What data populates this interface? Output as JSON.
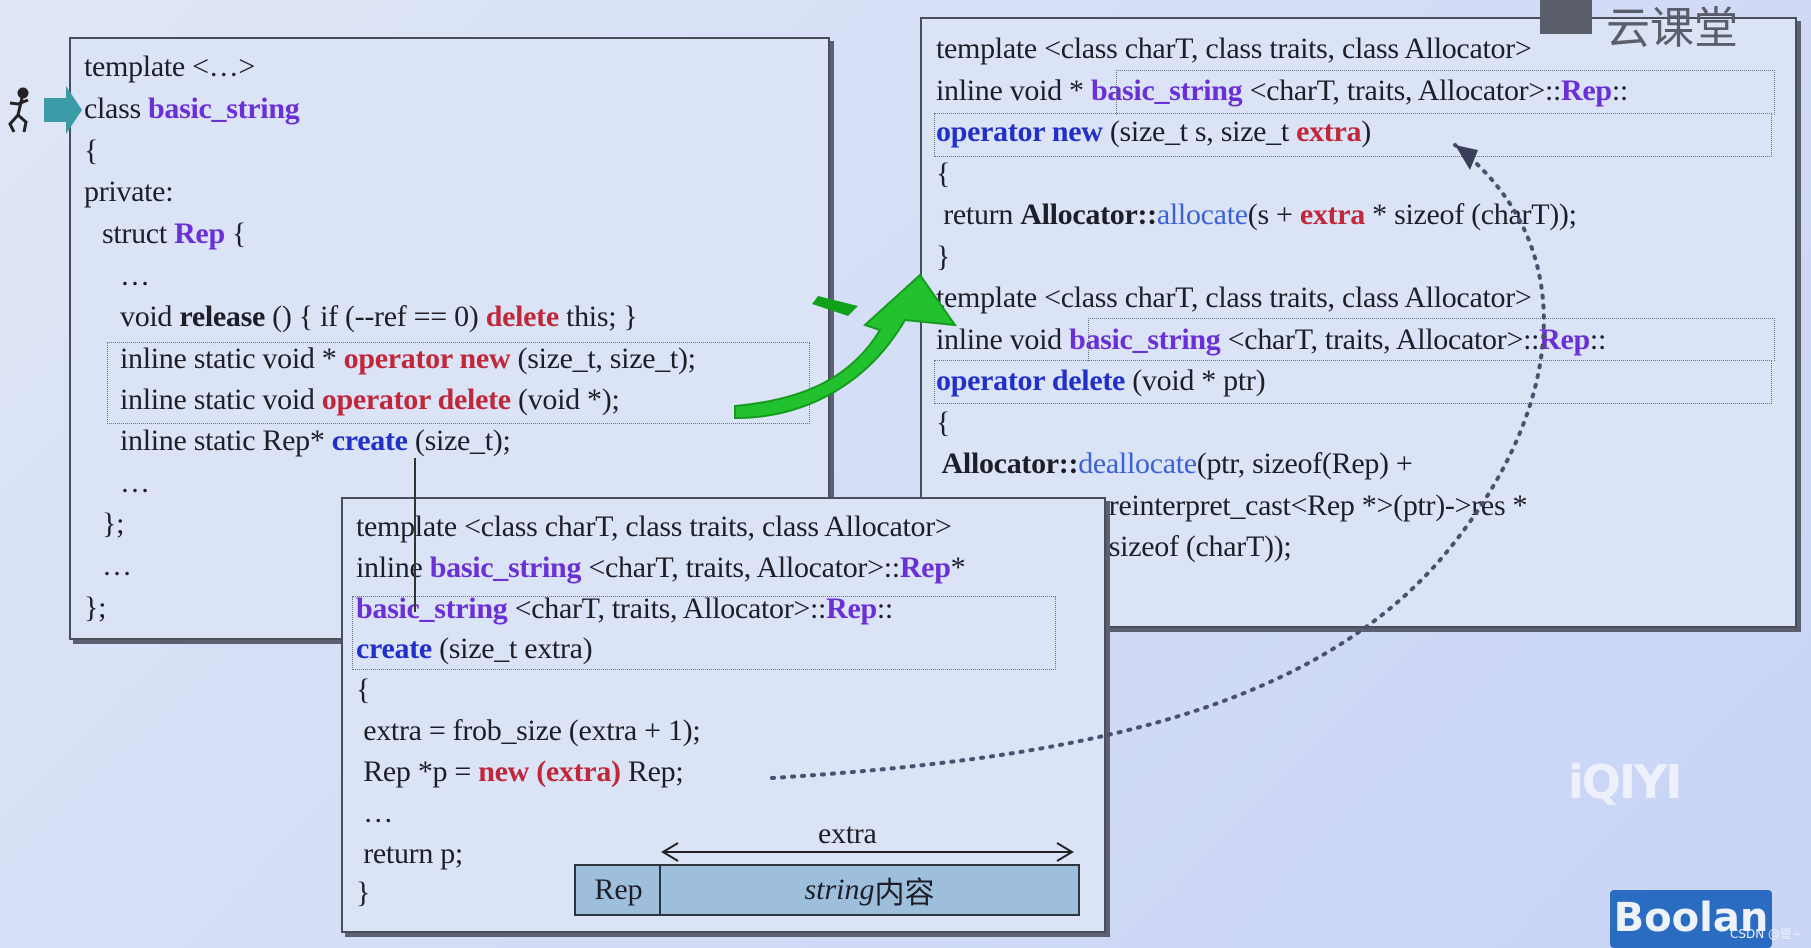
{
  "left_box": {
    "lines": [
      {
        "parts": [
          [
            "template <…>",
            ""
          ]
        ]
      },
      {
        "parts": [
          [
            "class ",
            ""
          ],
          [
            "basic_string",
            "kw-purple"
          ]
        ]
      },
      {
        "parts": [
          [
            "{",
            ""
          ]
        ]
      },
      {
        "parts": [
          [
            "private:",
            ""
          ]
        ]
      },
      {
        "parts": [
          [
            "struct ",
            ""
          ],
          [
            "Rep",
            "kw-purple"
          ],
          [
            " {",
            ""
          ]
        ]
      },
      {
        "parts": [
          [
            "…",
            ""
          ]
        ]
      },
      {
        "parts": [
          [
            "void ",
            ""
          ],
          [
            "release",
            "bold"
          ],
          [
            " () { if (--ref == 0) ",
            ""
          ],
          [
            "delete",
            "kw-red"
          ],
          [
            " this; }",
            ""
          ]
        ]
      },
      {
        "parts": [
          [
            "inline static void * ",
            ""
          ],
          [
            "operator new",
            "kw-red"
          ],
          [
            " (size_t, size_t);",
            ""
          ]
        ]
      },
      {
        "parts": [
          [
            "inline static void ",
            ""
          ],
          [
            "operator delete",
            "kw-red"
          ],
          [
            " (void *);",
            ""
          ]
        ]
      },
      {
        "parts": [
          [
            "inline static Rep* ",
            ""
          ],
          [
            "create",
            "kw-blue"
          ],
          [
            " (size_t);",
            ""
          ]
        ]
      },
      {
        "parts": [
          [
            "…",
            ""
          ]
        ]
      },
      {
        "parts": [
          [
            "};",
            ""
          ]
        ]
      },
      {
        "parts": [
          [
            "…",
            ""
          ]
        ]
      },
      {
        "parts": [
          [
            "};",
            ""
          ]
        ]
      }
    ]
  },
  "right_box": {
    "lines": [
      {
        "parts": [
          [
            "template <class charT, class traits, class Allocator>",
            ""
          ]
        ]
      },
      {
        "parts": [
          [
            "inline void * ",
            ""
          ],
          [
            "basic_string",
            "kw-purple"
          ],
          [
            " <charT, traits, Allocator>::",
            ""
          ],
          [
            "Rep",
            "kw-purple"
          ],
          [
            "::",
            ""
          ]
        ]
      },
      {
        "parts": [
          [
            "operator new",
            "kw-blue"
          ],
          [
            " (size_t s, size_t ",
            ""
          ],
          [
            "extra",
            "kw-red"
          ],
          [
            ")",
            ""
          ]
        ]
      },
      {
        "parts": [
          [
            "{",
            ""
          ]
        ]
      },
      {
        "parts": [
          [
            " return ",
            ""
          ],
          [
            "Allocator::",
            "bold"
          ],
          [
            "allocate",
            "kw-lblue"
          ],
          [
            "(s + ",
            ""
          ],
          [
            "extra",
            "kw-red"
          ],
          [
            " * sizeof (charT));",
            ""
          ]
        ]
      },
      {
        "parts": [
          [
            "}",
            ""
          ]
        ]
      },
      {
        "parts": [
          [
            "template <class charT, class traits, class Allocator>",
            ""
          ]
        ]
      },
      {
        "parts": [
          [
            "inline void ",
            ""
          ],
          [
            "basic_string",
            "kw-purple"
          ],
          [
            " <charT, traits, Allocator>::",
            ""
          ],
          [
            "Rep",
            "kw-purple"
          ],
          [
            "::",
            ""
          ]
        ]
      },
      {
        "parts": [
          [
            "operator delete",
            "kw-blue"
          ],
          [
            " (void * ptr)",
            ""
          ]
        ]
      },
      {
        "parts": [
          [
            "{",
            ""
          ]
        ]
      },
      {
        "parts": [
          [
            " Allocator::",
            "bold"
          ],
          [
            "deallocate",
            "kw-lblue"
          ],
          [
            "(ptr, sizeof(Rep) +",
            ""
          ]
        ]
      },
      {
        "parts": [
          [
            "                        reinterpret_cast<Rep *>(ptr)->res *",
            ""
          ]
        ]
      },
      {
        "parts": [
          [
            "                        sizeof (charT));",
            ""
          ]
        ]
      }
    ]
  },
  "bottom_box": {
    "lines": [
      {
        "parts": [
          [
            "template <class charT, class traits, class Allocator>",
            ""
          ]
        ]
      },
      {
        "parts": [
          [
            "inline ",
            ""
          ],
          [
            "basic_string",
            "kw-purple"
          ],
          [
            " <charT, traits, Allocator>::",
            ""
          ],
          [
            "Rep",
            "kw-purple"
          ],
          [
            "*",
            ""
          ]
        ]
      },
      {
        "parts": [
          [
            "basic_string",
            "kw-purple"
          ],
          [
            " <charT, traits, Allocator>::",
            ""
          ],
          [
            "Rep",
            "kw-purple"
          ],
          [
            "::",
            ""
          ]
        ]
      },
      {
        "parts": [
          [
            "create",
            "kw-blue"
          ],
          [
            " (size_t extra)",
            ""
          ]
        ]
      },
      {
        "parts": [
          [
            "{",
            ""
          ]
        ]
      },
      {
        "parts": [
          [
            " extra = frob_size (extra + 1);",
            ""
          ]
        ]
      },
      {
        "parts": [
          [
            " Rep *p = ",
            ""
          ],
          [
            "new (extra)",
            "kw-red"
          ],
          [
            " Rep;",
            ""
          ]
        ]
      },
      {
        "parts": [
          [
            " …",
            ""
          ]
        ]
      },
      {
        "parts": [
          [
            " return p;",
            ""
          ]
        ]
      },
      {
        "parts": [
          [
            "}",
            ""
          ]
        ]
      }
    ]
  },
  "memory_diagram": {
    "rep_label": "Rep",
    "content_label_italic": "string",
    "content_label_cn": " 内容",
    "span_label": "extra"
  },
  "watermarks": {
    "top_right": "云课堂",
    "iqiyi": "iQIYI",
    "boolan": "Boolan",
    "csdn": "CSDN @壹~"
  },
  "colors": {
    "purple": "#6a2fd6",
    "red": "#c0283a",
    "blue": "#2030c8",
    "arrow_green": "#22c22e",
    "pointer_teal": "#3a9aa6"
  }
}
